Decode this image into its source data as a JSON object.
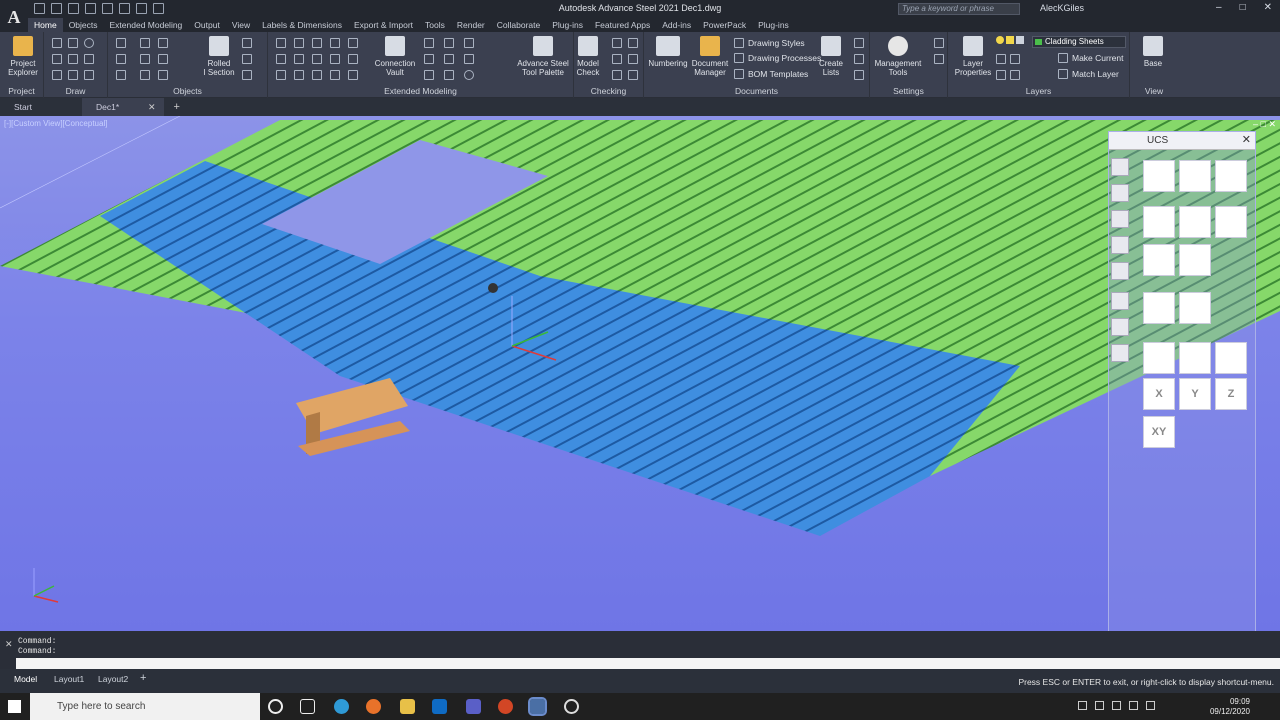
{
  "window": {
    "title": "Autodesk Advance Steel 2021   Dec1.dwg",
    "search_placeholder": "Type a keyword or phrase",
    "user": "AlecKGiles"
  },
  "app_logo": "A",
  "ribbon_tabs": [
    "Home",
    "Objects",
    "Extended Modeling",
    "Output",
    "View",
    "Labels & Dimensions",
    "Export & Import",
    "Tools",
    "Render",
    "Collaborate",
    "Plug-ins",
    "Featured Apps",
    "Add-ins",
    "PowerPack",
    "Plug-ins"
  ],
  "ribbon": {
    "project_explorer": "Project\nExplorer",
    "rolled_section": "Rolled\nI Section",
    "connection_vault": "Connection\nVault",
    "tool_palette": "Advance Steel\nTool Palette",
    "model_check": "Model\nCheck",
    "numbering": "Numbering",
    "document_manager": "Document\nManager",
    "drawing_styles": "Drawing Styles",
    "drawing_processes": "Drawing Processes",
    "bom_templates": "BOM Templates",
    "create_lists": "Create\nLists",
    "management_tools": "Management\nTools",
    "layer_properties": "Layer\nProperties",
    "layer_current": "Cladding Sheets",
    "make_current": "Make Current",
    "match_layer": "Match Layer",
    "base": "Base",
    "panels": {
      "project": "Project",
      "draw": "Draw",
      "objects": "Objects",
      "extended_modeling": "Extended Modeling",
      "checking": "Checking",
      "documents": "Documents",
      "settings": "Settings",
      "layers": "Layers",
      "view": "View"
    }
  },
  "doc_tabs": [
    "Start",
    "Dec1*"
  ],
  "viewport": {
    "label": "[-][Custom View][Conceptual]"
  },
  "ucs_palette": {
    "title": "UCS",
    "buttons": [
      "X",
      "Y",
      "Z",
      "XY"
    ]
  },
  "command": {
    "lines": [
      "Command:",
      "Command:"
    ]
  },
  "layout_tabs": [
    "Model",
    "Layout1",
    "Layout2"
  ],
  "status_message": "Press ESC or ENTER to exit, or right-click to display shortcut-menu.",
  "taskbar": {
    "search": "Type here to search",
    "time": "09:09",
    "date": "09/12/2020"
  },
  "colors": {
    "deck_green": "#86d86a",
    "deck_blue": "#3f8ee0",
    "viewport_bg": "#7c83e9",
    "beam": "#e0a565"
  }
}
